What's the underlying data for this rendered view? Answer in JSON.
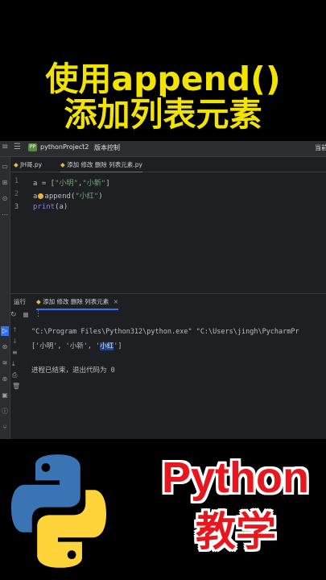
{
  "banner": {
    "line1": "使用append()",
    "line2": "添加列表元素"
  },
  "topbar": {
    "project_badge": "PP",
    "project_name": "pythonProject2",
    "vcs_label": "版本控制",
    "right_label": "当前"
  },
  "editor": {
    "tabs": [
      {
        "label": "JH哥.py"
      },
      {
        "label": "添加 修改 删除 列表元素.py"
      }
    ],
    "line_numbers": [
      "1",
      "2",
      "3"
    ],
    "lines": [
      {
        "a": "a = [",
        "s1": "\"小明\"",
        "m": ",",
        "s2": "\"小新\"",
        "e": "]"
      },
      {
        "a": "a",
        "b": "append(",
        "s": "\"小红\"",
        "e": ")"
      },
      {
        "fn": "print",
        "e": "(a)"
      }
    ]
  },
  "run_panel": {
    "tab_run": "运行",
    "tab_config": "添加 修改 删除 列表元素",
    "output": {
      "cmd": "\"C:\\Program Files\\Python312\\python.exe\" \"C:\\Users\\jingh\\PycharmPr",
      "result_pre": "['小明', '小新', '",
      "result_sel": "小红",
      "result_post": "']",
      "exit": "进程已结束，退出代码为 0"
    }
  },
  "footer": {
    "title": "Python",
    "subtitle": "教学"
  },
  "colors": {
    "headline": "#f2e400",
    "python_red": "#e8171d",
    "logo_blue": "#3b74b5",
    "logo_yellow": "#ffd43b"
  }
}
